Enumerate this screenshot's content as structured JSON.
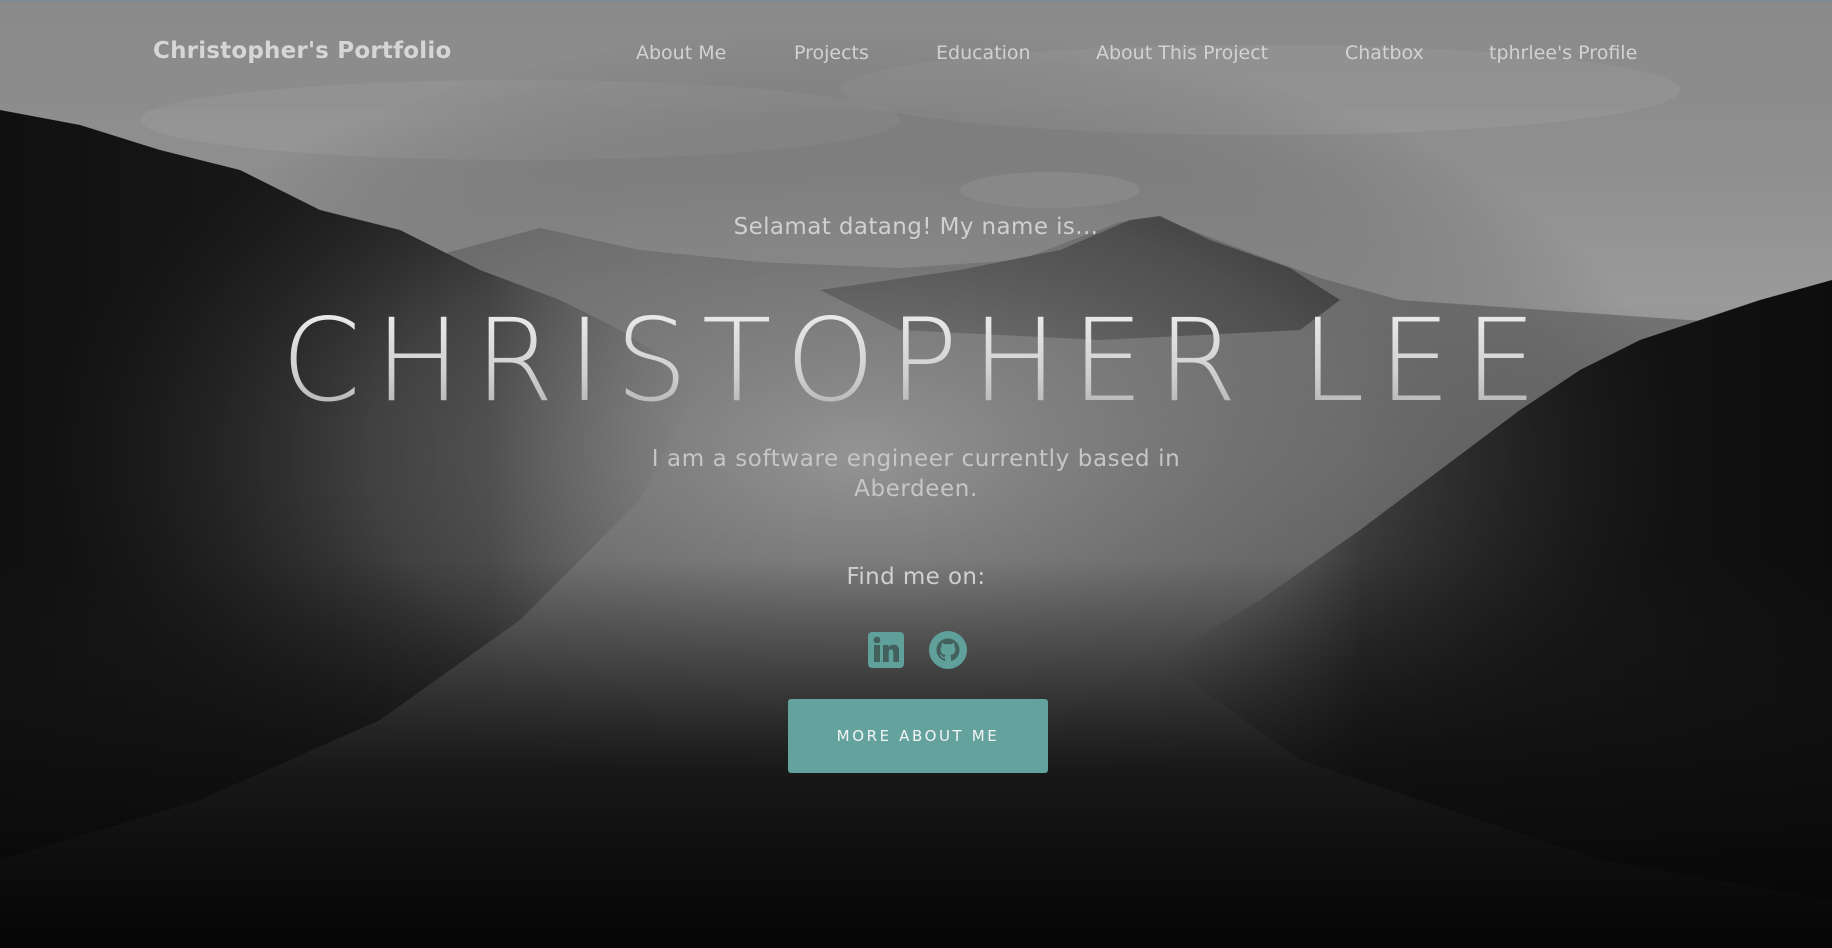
{
  "nav": {
    "brand": "Christopher's Portfolio",
    "links": [
      {
        "label": "About Me"
      },
      {
        "label": "Projects"
      },
      {
        "label": "Education"
      },
      {
        "label": "About This Project"
      },
      {
        "label": "Chatbox"
      },
      {
        "label": "tphrlee's Profile"
      }
    ]
  },
  "hero": {
    "greeting": "Selamat datang! My name is...",
    "name": "CHRISTOPHER LEE",
    "tagline": "I am a software engineer currently based in Aberdeen.",
    "find_me": "Find me on:",
    "socials": [
      {
        "icon": "linkedin-icon"
      },
      {
        "icon": "github-icon"
      }
    ],
    "cta_label": "MORE ABOUT ME"
  },
  "colors": {
    "accent": "#64a39d",
    "icon": "#5fa09a",
    "text_light": "#d0d0d0"
  }
}
